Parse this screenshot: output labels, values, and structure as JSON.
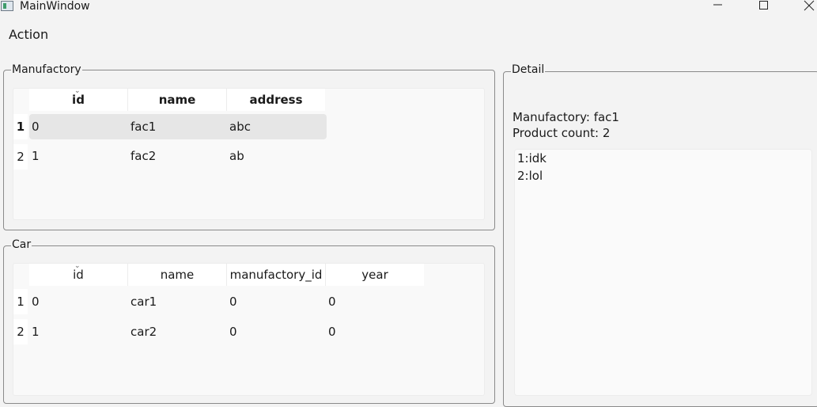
{
  "window": {
    "title": "MainWindow"
  },
  "menubar": {
    "items": [
      "Action"
    ]
  },
  "manufactory": {
    "title": "Manufactory",
    "columns": [
      "id",
      "name",
      "address"
    ],
    "row_headers": [
      "1",
      "2"
    ],
    "rows": [
      [
        "0",
        "fac1",
        "abc"
      ],
      [
        "1",
        "fac2",
        "ab"
      ]
    ]
  },
  "car": {
    "title": "Car",
    "columns": [
      "id",
      "name",
      "manufactory_id",
      "year"
    ],
    "row_headers": [
      "1",
      "2"
    ],
    "rows": [
      [
        "0",
        "car1",
        "0",
        "0"
      ],
      [
        "1",
        "car2",
        "0",
        "0"
      ]
    ]
  },
  "detail": {
    "title": "Detail",
    "manufactory_line": "Manufactory: fac1",
    "count_line": "Product count: 2",
    "products": [
      "1:idk",
      "2:lol"
    ]
  },
  "icons": {
    "sort": "chevron-down-icon",
    "minimize": "minimize-icon",
    "maximize": "maximize-icon",
    "close": "close-icon",
    "app": "app-icon"
  }
}
